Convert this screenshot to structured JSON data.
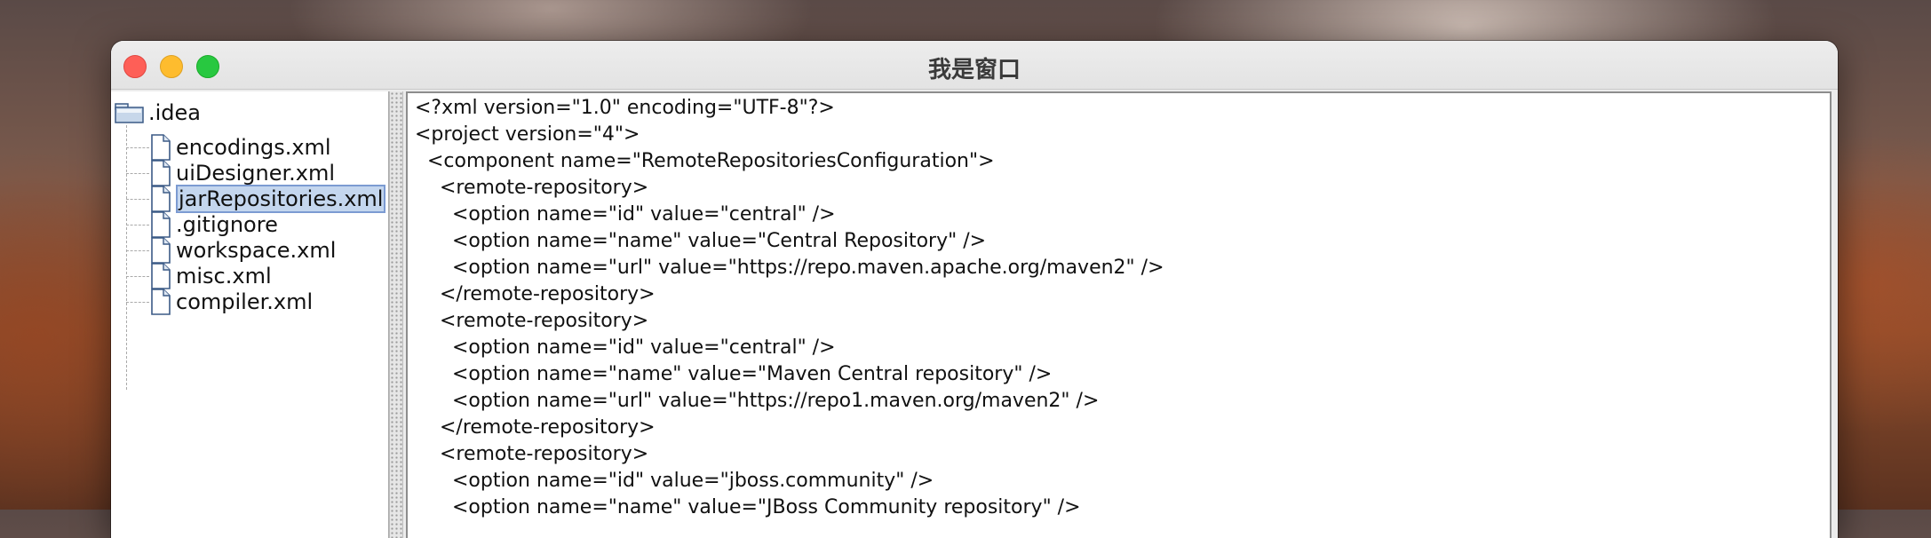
{
  "window": {
    "title": "我是窗口"
  },
  "tree": {
    "root": {
      "label": ".idea",
      "icon": "folder-icon"
    },
    "children": [
      {
        "label": "encodings.xml",
        "icon": "file-icon",
        "selected": false
      },
      {
        "label": "uiDesigner.xml",
        "icon": "file-icon",
        "selected": false
      },
      {
        "label": "jarRepositories.xml",
        "icon": "file-icon",
        "selected": true
      },
      {
        "label": ".gitignore",
        "icon": "file-icon",
        "selected": false
      },
      {
        "label": "workspace.xml",
        "icon": "file-icon",
        "selected": false
      },
      {
        "label": "misc.xml",
        "icon": "file-icon",
        "selected": false
      },
      {
        "label": "compiler.xml",
        "icon": "file-icon",
        "selected": false
      }
    ]
  },
  "editor": {
    "lines": [
      "<?xml version=\"1.0\" encoding=\"UTF-8\"?>",
      "<project version=\"4\">",
      "  <component name=\"RemoteRepositoriesConfiguration\">",
      "    <remote-repository>",
      "      <option name=\"id\" value=\"central\" />",
      "      <option name=\"name\" value=\"Central Repository\" />",
      "      <option name=\"url\" value=\"https://repo.maven.apache.org/maven2\" />",
      "    </remote-repository>",
      "    <remote-repository>",
      "      <option name=\"id\" value=\"central\" />",
      "      <option name=\"name\" value=\"Maven Central repository\" />",
      "      <option name=\"url\" value=\"https://repo1.maven.org/maven2\" />",
      "    </remote-repository>",
      "    <remote-repository>",
      "      <option name=\"id\" value=\"jboss.community\" />",
      "      <option name=\"name\" value=\"JBoss Community repository\" />"
    ]
  },
  "colors": {
    "selection_bg": "#c4d6ee",
    "selection_border": "#7c9bd2",
    "close": "#fe5f57",
    "minimize": "#febc2e",
    "maximize": "#28c840"
  }
}
